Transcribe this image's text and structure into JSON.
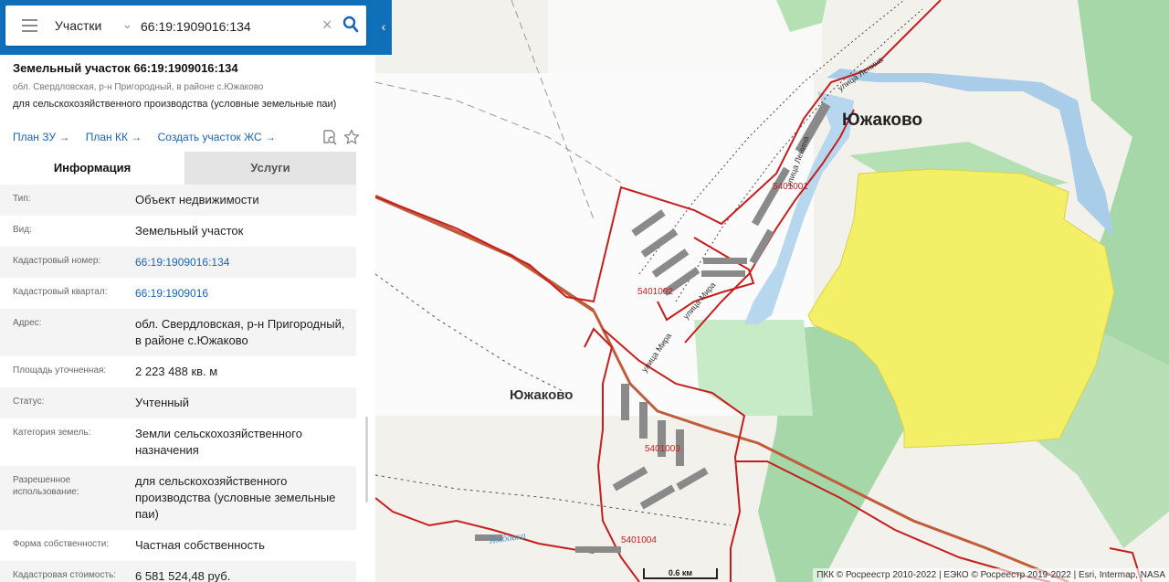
{
  "search": {
    "type_label": "Участки",
    "query": "66:19:1909016:134"
  },
  "parcel": {
    "title": "Земельный участок 66:19:1909016:134",
    "address_short": "обл. Свердловская, р-н Пригородный, в районе с.Южаково",
    "purpose": "для сельскохозяйственного производства (условные земельные паи)"
  },
  "links": {
    "plan_zu": "План ЗУ →",
    "plan_kk": "План КК →",
    "create": "Создать участок ЖС →"
  },
  "tabs": {
    "info": "Информация",
    "services": "Услуги"
  },
  "rows": [
    {
      "label": "Тип:",
      "value": "Объект недвижимости"
    },
    {
      "label": "Вид:",
      "value": "Земельный участок"
    },
    {
      "label": "Кадастровый номер:",
      "value": "66:19:1909016:134"
    },
    {
      "label": "Кадастровый квартал:",
      "value": "66:19:1909016"
    },
    {
      "label": "Адрес:",
      "value": "обл. Свердловская, р-н Пригородный, в районе с.Южаково"
    },
    {
      "label": "Площадь уточненная:",
      "value": "2 223 488 кв. м"
    },
    {
      "label": "Статус:",
      "value": "Учтенный"
    },
    {
      "label": "Категория земель:",
      "value": "Земли сельскохозяйственного назначения"
    },
    {
      "label": "Разрешенное использование:",
      "value": "для сельскохозяйственного производства (условные земельные паи)"
    },
    {
      "label": "Форма собственности:",
      "value": "Частная собственность"
    },
    {
      "label": "Кадастровая стоимость:",
      "value": "6 581 524,48 руб."
    }
  ],
  "map": {
    "village_label_1": "Южаково",
    "village_label_2": "Южаково",
    "street_1": "улица Ленина",
    "street_2": "улица Ленина",
    "street_3": "улица Мира",
    "street_4": "улица Мира",
    "quarter_1": "5401001",
    "quarter_2": "5401002",
    "quarter_3": "5401003",
    "quarter_4": "5401004",
    "river": "Ямбовка",
    "scale": "0.6 км",
    "credits": "ПКК © Росреестр 2010-2022 | ЕЭКО © Росреестр 2019-2022 | Esri, Intermap, NASA"
  },
  "colors": {
    "header_blue": "#0f6fb9",
    "link_blue": "#1a63b5",
    "parcel_yellow": "#f3ef66",
    "boundary_red": "#c41e1e",
    "water_blue": "#a9cde8",
    "forest_green": "#a6d7a8"
  }
}
